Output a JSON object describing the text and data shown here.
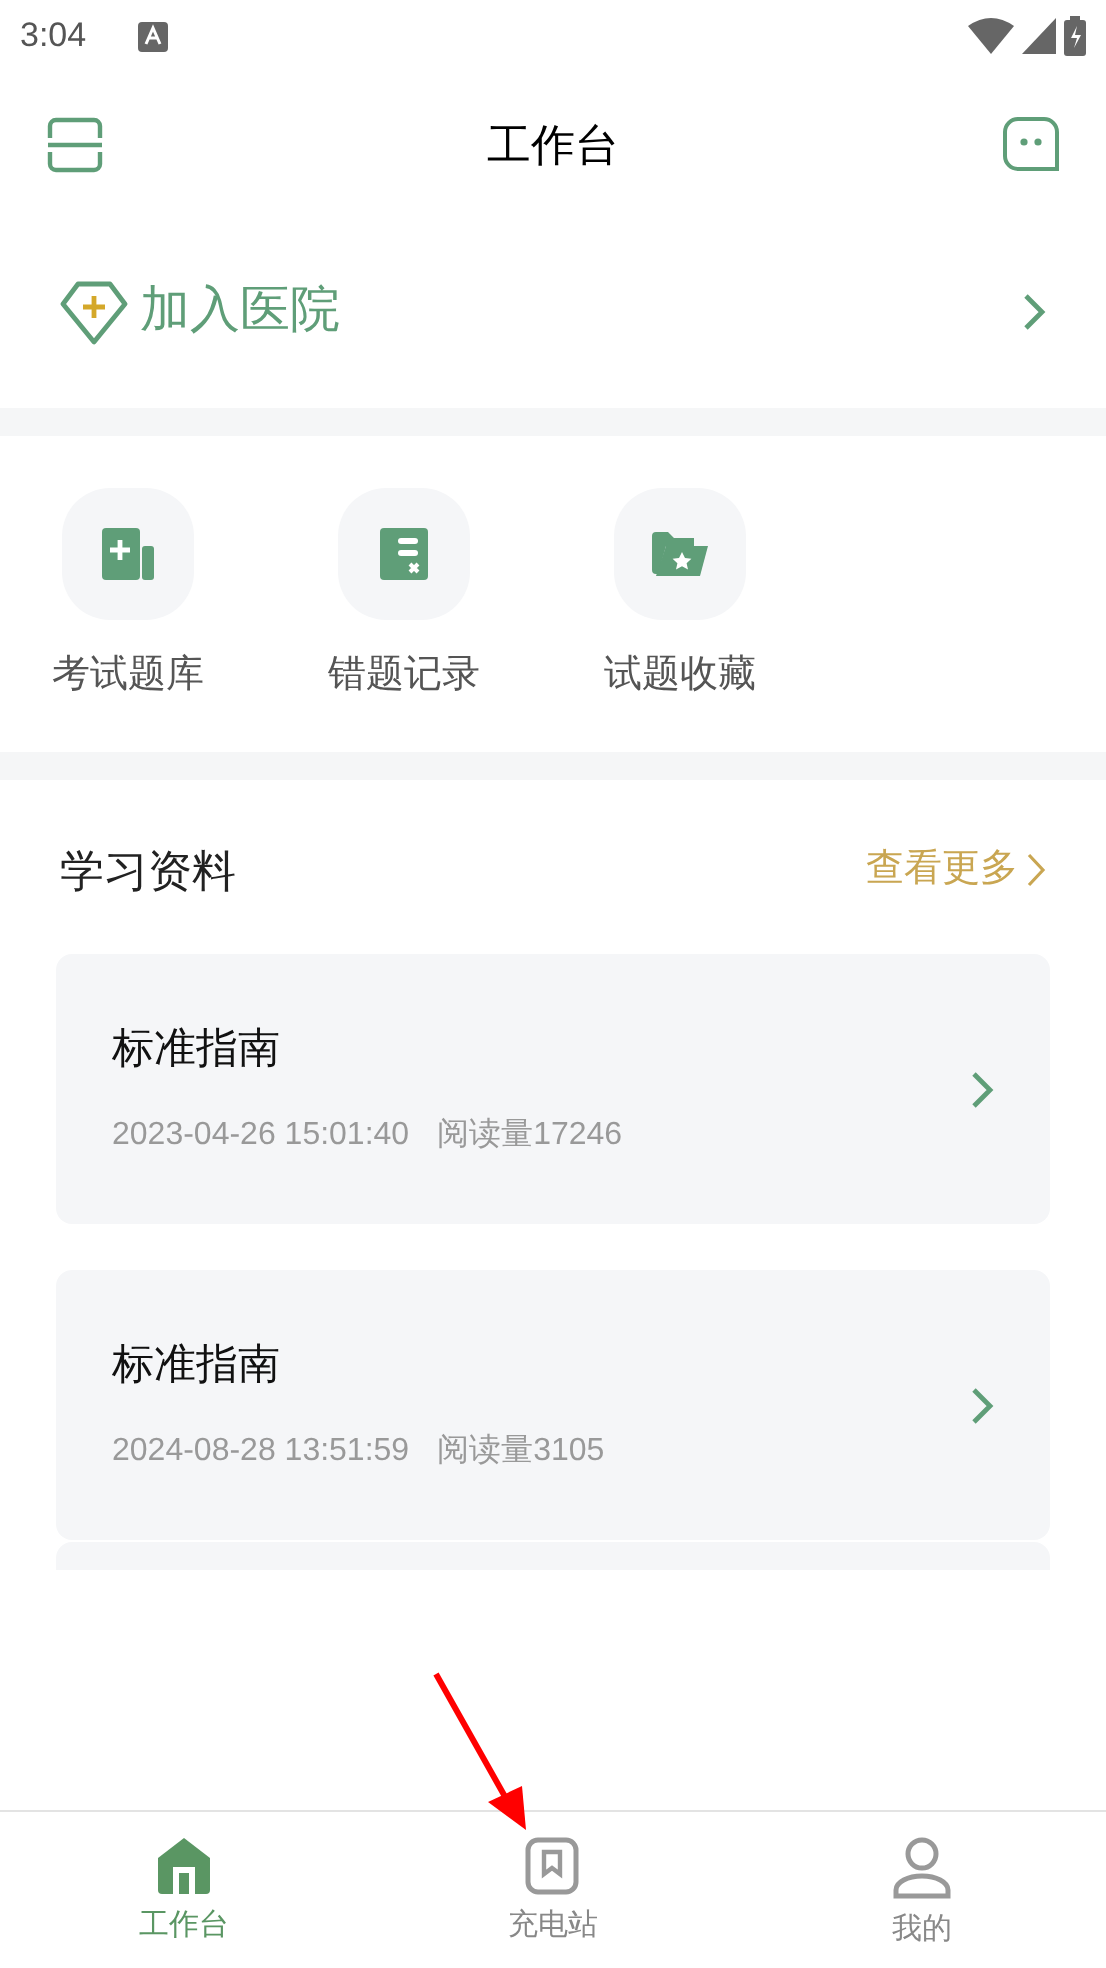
{
  "status_bar": {
    "time": "3:04"
  },
  "header": {
    "title": "工作台"
  },
  "join_hospital": {
    "label": "加入医院"
  },
  "shortcuts": [
    {
      "kind": "bank",
      "label": "考试题库"
    },
    {
      "kind": "mistakes",
      "label": "错题记录"
    },
    {
      "kind": "favorites",
      "label": "试题收藏"
    }
  ],
  "materials": {
    "title": "学习资料",
    "more": "查看更多",
    "items": [
      {
        "title": "标准指南",
        "date": "2023-04-26 15:01:40",
        "reads": "阅读量17246"
      },
      {
        "title": "标准指南",
        "date": "2024-08-28 13:51:59",
        "reads": "阅读量3105"
      }
    ]
  },
  "tab_bar": [
    {
      "kind": "home",
      "label": "工作台",
      "selected": true
    },
    {
      "kind": "bookmark",
      "label": "充电站",
      "selected": false
    },
    {
      "kind": "profile",
      "label": "我的",
      "selected": false
    }
  ]
}
